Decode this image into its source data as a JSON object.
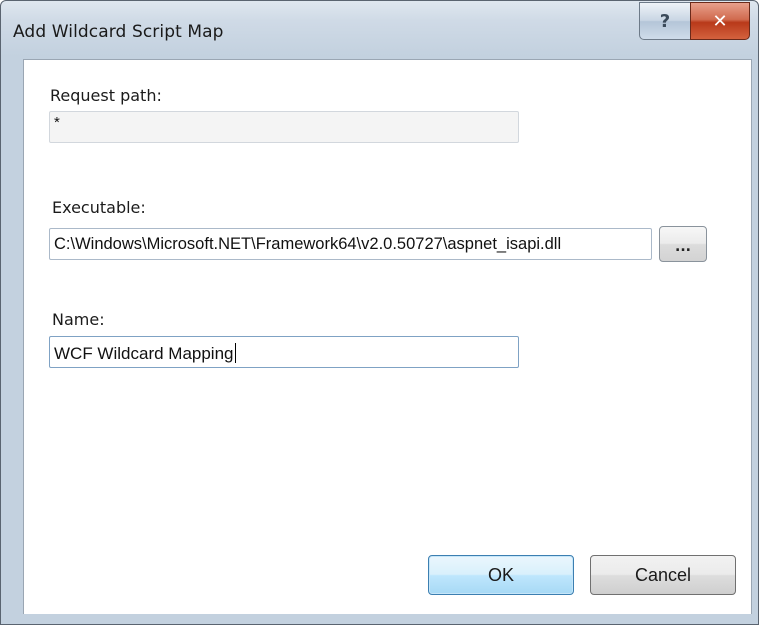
{
  "window": {
    "title": "Add Wildcard Script Map",
    "help_button": "?",
    "close_button": "✕"
  },
  "form": {
    "request_path": {
      "label": "Request path:",
      "value": "*"
    },
    "executable": {
      "label": "Executable:",
      "value": "C:\\Windows\\Microsoft.NET\\Framework64\\v2.0.50727\\aspnet_isapi.dll",
      "browse_label": "..."
    },
    "name": {
      "label": "Name:",
      "value": "WCF Wildcard Mapping"
    }
  },
  "buttons": {
    "ok_label": "OK",
    "cancel_label": "Cancel"
  },
  "icons": {
    "help": "help-icon",
    "close": "close-icon"
  },
  "colors": {
    "titlebar": "#cfdae6",
    "close_button": "#c7472a",
    "ok_button_border": "#3c7fb1"
  }
}
